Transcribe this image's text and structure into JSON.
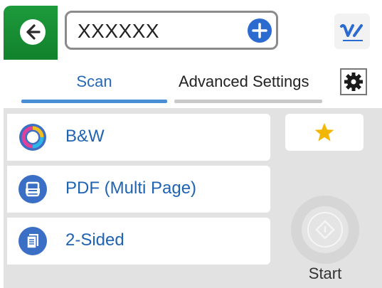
{
  "header": {
    "destination_value": "XXXXXX"
  },
  "tabs": [
    {
      "label": "Scan",
      "active": true
    },
    {
      "label": "Advanced Settings",
      "active": false
    }
  ],
  "options": [
    {
      "label": "B&W",
      "icon": "color-mode-icon"
    },
    {
      "label": "PDF (Multi Page)",
      "icon": "file-format-icon"
    },
    {
      "label": "2-Sided",
      "icon": "two-sided-icon"
    }
  ],
  "start": {
    "label": "Start"
  },
  "colors": {
    "back_green": "#1d9a3b",
    "accent_blue": "#2569b8",
    "panel_gray": "#e2e2e2",
    "star_yellow": "#f2b705"
  }
}
